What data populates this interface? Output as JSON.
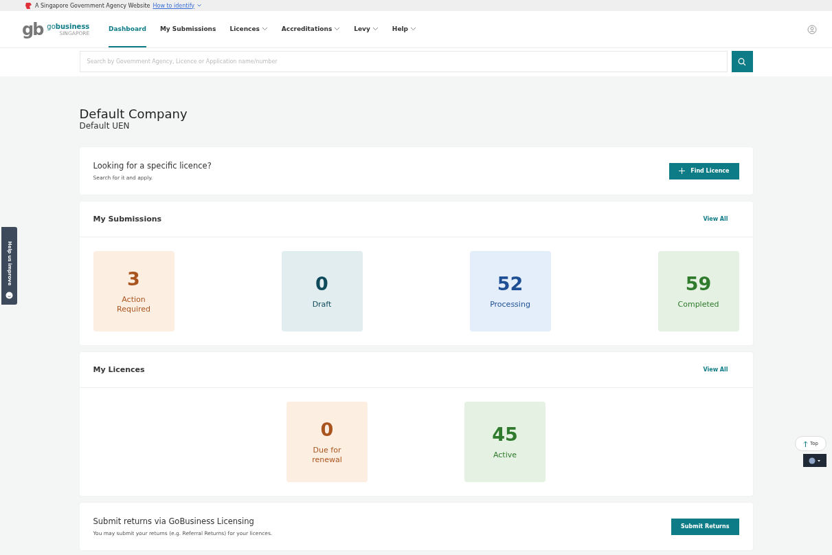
{
  "gov_banner": {
    "text": "A Singapore Government Agency Website",
    "link": "How to identify"
  },
  "logo": {
    "mark": "gb",
    "name_prefix": "go",
    "name_main": "business",
    "tagline": "SINGAPORE"
  },
  "nav": [
    {
      "label": "Dashboard",
      "selected": true,
      "dropdown": false
    },
    {
      "label": "My Submissions",
      "selected": false,
      "dropdown": false
    },
    {
      "label": "Licences",
      "selected": false,
      "dropdown": true
    },
    {
      "label": "Accreditations",
      "selected": false,
      "dropdown": true
    },
    {
      "label": "Levy",
      "selected": false,
      "dropdown": true
    },
    {
      "label": "Help",
      "selected": false,
      "dropdown": true
    }
  ],
  "search": {
    "placeholder": "Search by Government Agency, Licence or Application name/number"
  },
  "company": {
    "name": "Default Company",
    "uen": "Default UEN"
  },
  "find_licence": {
    "title": "Looking for a specific licence?",
    "subtitle": "Search for it and apply.",
    "button": "Find Licence"
  },
  "submissions": {
    "title": "My Submissions",
    "view_all": "View All",
    "tiles": [
      {
        "kind": "action",
        "count": "3",
        "label": "Action Required"
      },
      {
        "kind": "draft",
        "count": "0",
        "label": "Draft"
      },
      {
        "kind": "processing",
        "count": "52",
        "label": "Processing"
      },
      {
        "kind": "completed",
        "count": "59",
        "label": "Completed"
      }
    ]
  },
  "licences": {
    "title": "My Licences",
    "view_all": "View All",
    "tiles": [
      {
        "kind": "renewal",
        "count": "0",
        "label": "Due for renewal"
      },
      {
        "kind": "active",
        "count": "45",
        "label": "Active"
      }
    ]
  },
  "returns": {
    "title": "Submit returns via GoBusiness Licensing",
    "subtitle": "You may submit your returns (e.g. Referral Returns) for your licences.",
    "button": "Submit Returns"
  },
  "feedback_tab": {
    "label": "Help us improve"
  },
  "top_button": {
    "label": "Top"
  }
}
